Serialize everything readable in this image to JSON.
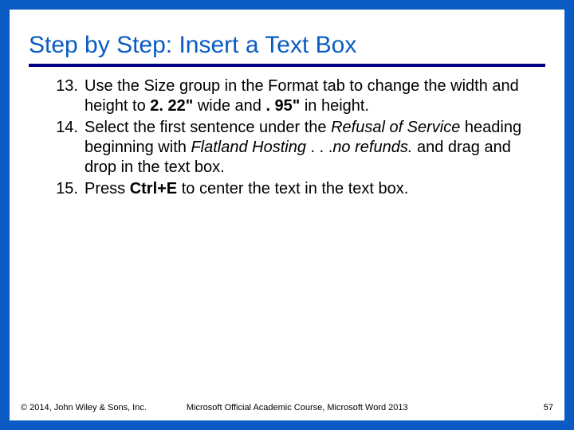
{
  "title": "Step by Step: Insert a Text Box",
  "steps": [
    {
      "n": "13.",
      "html": "Use the Size group in the Format tab to change the width and height to <b>2. 22\"</b> wide and <b>. 95\"</b> in height."
    },
    {
      "n": "14.",
      "html": "Select the first sentence under the <i>Refusal of Service</i> heading beginning with <i>Flatland Hosting</i> . . .<i>no refunds.</i> and drag and drop in the text box."
    },
    {
      "n": "15.",
      "html": "Press <b>Ctrl+E</b> to center the text in the text box."
    }
  ],
  "footer": {
    "copyright": "© 2014, John Wiley & Sons, Inc.",
    "course": "Microsoft Official Academic Course, Microsoft Word 2013",
    "page": "57"
  }
}
